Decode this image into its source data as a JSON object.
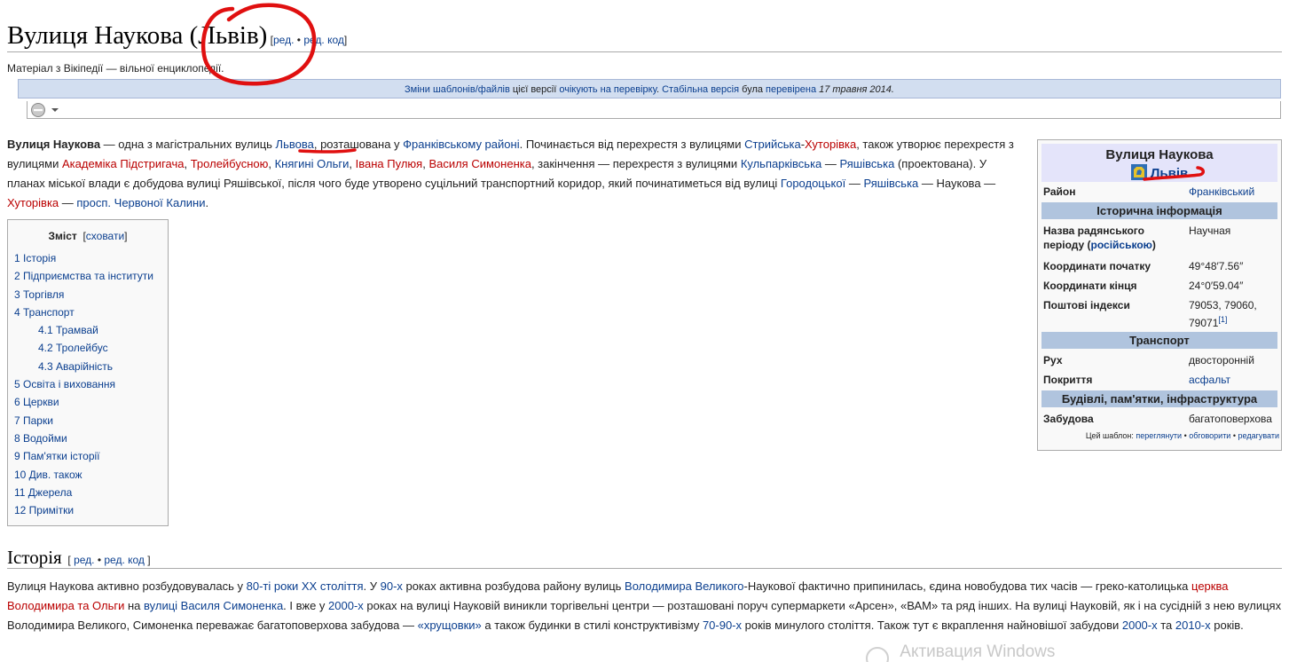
{
  "header": {
    "title": "Вулиця Наукова (Львів)",
    "edit_label": "ред.",
    "dot": "•",
    "edit_code_label": "ред. код",
    "tagline": "Матеріал з Вікіпедії — вільної енциклопедії."
  },
  "flagged": {
    "link1": "Зміни шаблонів/файлів",
    "text1": " цієї версії ",
    "link2": "очікують на перевірку",
    "text2": ". ",
    "link3": "Стабільна версія",
    "text3": " була ",
    "link4": "перевірена",
    "date": " 17 травня 2014."
  },
  "lead": {
    "t1": "Вулиця Наукова",
    "t2": " — одна з магістральних вулиць ",
    "l_lviv": "Львова",
    "t3": ", розташована у ",
    "l_frank": "Франківському районі",
    "t4": ". Починається від перехрестя з вулицями ",
    "l_stryiska": "Стрийська",
    "dash": "-",
    "l_khutorivka": "Хуторівка",
    "t5": ", також утворює перехрестя з вулицями ",
    "l_akad": "Академіка Підстригача",
    "comma": ", ",
    "l_troleib": "Тролейбусною",
    "l_knyahyni": "Княгині Ольги",
    "l_pulyuya": "Івана Пулюя",
    "l_symon": "Василя Симоненка",
    "t6": ", закінчення — перехрестя з вулицями ",
    "l_kulpark": "Кульпарківська",
    "mdash": " — ",
    "l_ryash": "Ряшівська",
    "t7": " (проектована). У планах міської влади є добудова вулиці Ряшівської, після чого буде утворено суцільний транспортний коридор, який починатиметься від вулиці ",
    "l_horod": "Городоцької",
    "l_ryash2": "Ряшівська",
    "t8": " — Наукова — ",
    "l_khut2": "Хуторівка",
    "l_prosp": "просп. Червоної Калини",
    "dot": "."
  },
  "toc": {
    "title": "Зміст",
    "hide": "сховати",
    "items": [
      {
        "label": "1 Історія"
      },
      {
        "label": "2 Підприємства та інститути"
      },
      {
        "label": "3 Торгівля"
      },
      {
        "label": "4 Транспорт"
      },
      {
        "label": "4.1 Трамвай"
      },
      {
        "label": "4.2 Тролейбус"
      },
      {
        "label": "4.3 Аварійність"
      },
      {
        "label": "5 Освіта і виховання"
      },
      {
        "label": "6 Церкви"
      },
      {
        "label": "7 Парки"
      },
      {
        "label": "8 Водойми"
      },
      {
        "label": "9 Пам'ятки історії"
      },
      {
        "label": "10 Див. також"
      },
      {
        "label": "11 Джерела"
      },
      {
        "label": "12 Примітки"
      }
    ]
  },
  "infobox": {
    "title": "Вулиця Наукова",
    "city": "Львів",
    "district_k": "Район",
    "district_v": "Франківський",
    "sec_hist": "Історична інформація",
    "soviet_k1": "Назва радянського періоду (",
    "soviet_link": "російською",
    "soviet_k2": ")",
    "soviet_v": "Научная",
    "coord_start_k": "Координати початку",
    "coord_start_v": "49°48′7.56″",
    "coord_end_k": "Координати кінця",
    "coord_end_v": "24°0′59.04″",
    "postal_k": "Поштові індекси",
    "postal_v": "79053, 79060, 79071",
    "postal_ref": "[1]",
    "sec_transport": "Транспорт",
    "traffic_k": "Рух",
    "traffic_v": "двосторонній",
    "surface_k": "Покриття",
    "surface_v": "асфальт",
    "sec_build": "Будівлі, пам'ятки, інфраструктура",
    "build_k": "Забудова",
    "build_v": "багатоповерхова",
    "foot_text": "Цей шаблон: ",
    "foot_view": "переглянути",
    "foot_discuss": "обговорити",
    "foot_edit": "редагувати",
    "foot_sep": " • "
  },
  "history": {
    "heading": "Історія",
    "p1": "Вулиця Наукова активно розбудовувалась у ",
    "l1": "80-ті роки XX століття",
    "p2": ". У ",
    "l2": "90-х",
    "p3": " роках активна розбудова району вулиць ",
    "l3": "Володимира Великого",
    "p4": "-Наукової фактично припинилась, єдина новобудова тих часів — греко-католицька ",
    "l4": "церква Володимира та Ольги",
    "p5": " на ",
    "l5": "вулиці Василя Симоненка",
    "p6": ". І вже у ",
    "l6": "2000-х",
    "p7": " роках на вулиці Науковій виникли торгівельні центри — розташовані поруч супермаркети «Арсен», «ВАМ» та ряд інших. На вулиці Науковій, як і на сусідній з нею вулицях Володимира Великого, Симоненка переважає багатоповерхова забудова — ",
    "l7": "«хрущовки»",
    "p8": " а також будинки в стилі конструктивізму ",
    "l8": "70-90-х",
    "p9": " років минулого століття. Також тут є вкраплення найновішої забудови ",
    "l9": "2000-х",
    "p10": " та ",
    "l10": "2010-х",
    "p11": " років."
  },
  "watermark": "Активация Windows",
  "colors": {
    "link": "#0b3f8f",
    "redlink": "#ba0000",
    "annotation": "#e01010"
  }
}
